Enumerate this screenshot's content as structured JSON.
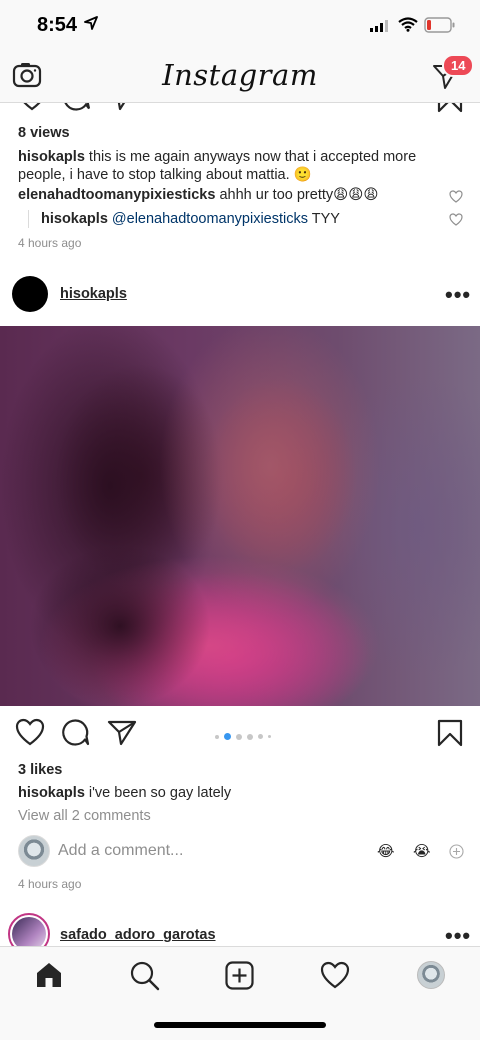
{
  "status_bar": {
    "time": "8:54"
  },
  "header": {
    "title": "Instagram",
    "notification_count": "14"
  },
  "prev_post": {
    "views": "8 views",
    "caption_user": "hisokapls",
    "caption_text": " this is me again anyways now that i accepted more people, i have to stop talking about mattia. 🙂",
    "comments": [
      {
        "user": "elenahadtoomanypixiesticks",
        "text": " ahhh ur too pretty😩😩😩"
      },
      {
        "user": "hisokapls",
        "mention": " @elenahadtoomanypixiesticks",
        "text": " TYY"
      }
    ],
    "time_ago": "4 hours ago"
  },
  "post": {
    "username": "hisokapls",
    "likes": "3 likes",
    "caption_user": "hisokapls",
    "caption_text": " i've been so gay lately",
    "view_comments": "View all 2 comments",
    "add_comment_placeholder": "Add a comment...",
    "quick_emojis": [
      "😂",
      "😭"
    ],
    "time_ago": "4 hours ago",
    "carousel_count": 6,
    "carousel_active": 1
  },
  "next_post": {
    "username": "safado_adoro_garotas"
  },
  "colors": {
    "badge": "#ed4956",
    "mention": "#003569",
    "active_dot": "#3897f0"
  }
}
